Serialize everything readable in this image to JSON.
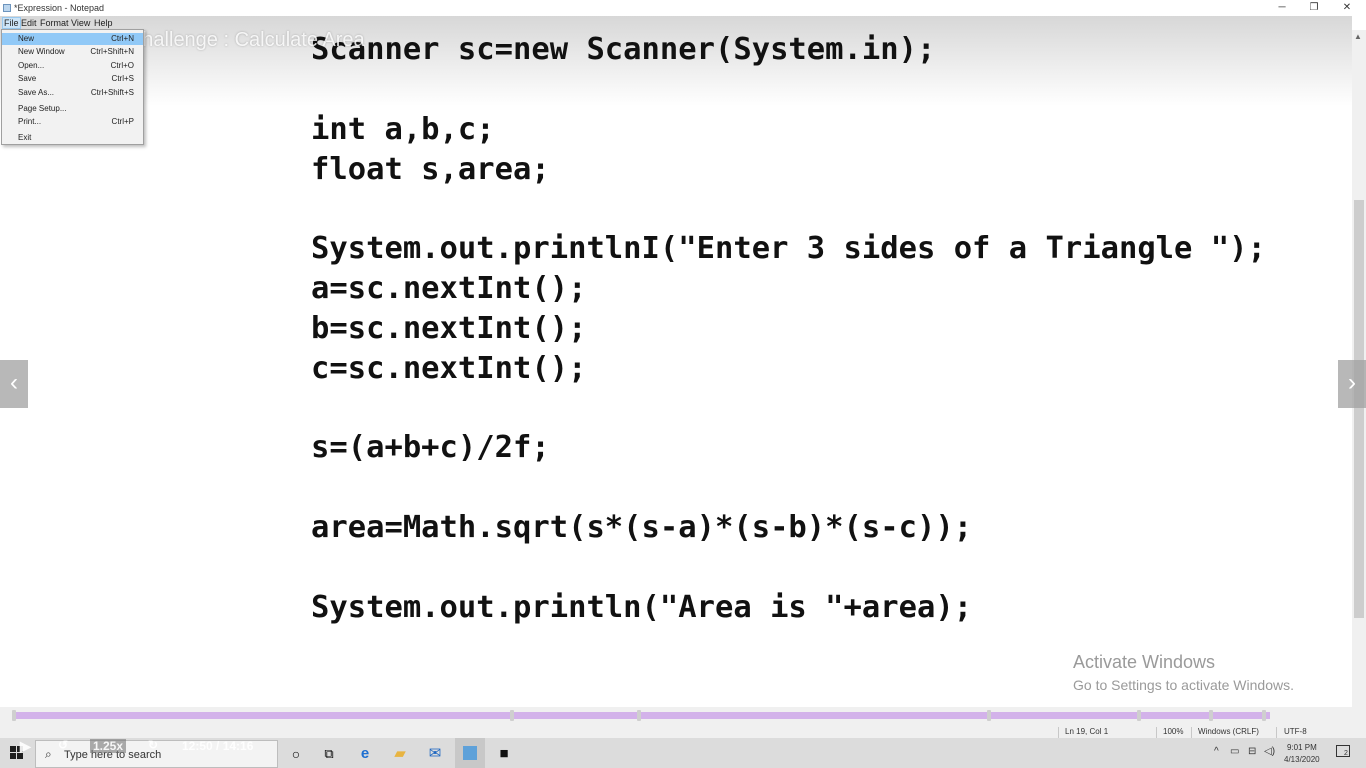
{
  "window": {
    "title": "*Expression - Notepad",
    "controls": {
      "minimize": "─",
      "maximize": "❐",
      "close": "✕"
    }
  },
  "menubar": {
    "items": [
      "File",
      "Edit",
      "Format",
      "View",
      "Help"
    ]
  },
  "video": {
    "title": "31. Student Challenge : Calculate Area",
    "speed": "1.25x",
    "time": "12:50 / 14:16",
    "prev_arrow": "‹",
    "next_arrow": "›"
  },
  "file_menu": [
    {
      "label": "New",
      "shortcut": "Ctrl+N"
    },
    {
      "label": "New Window",
      "shortcut": "Ctrl+Shift+N"
    },
    {
      "label": "Open...",
      "shortcut": "Ctrl+O"
    },
    {
      "label": "Save",
      "shortcut": "Ctrl+S"
    },
    {
      "label": "Save As...",
      "shortcut": "Ctrl+Shift+S"
    },
    {
      "label": "Page Setup...",
      "shortcut": ""
    },
    {
      "label": "Print...",
      "shortcut": "Ctrl+P"
    },
    {
      "label": "Exit",
      "shortcut": ""
    }
  ],
  "editor": {
    "lines": [
      "Scanner sc=new Scanner(System.in);",
      "",
      "int a,b,c;",
      "float s,area;",
      "",
      "System.out.printlnI(\"Enter 3 sides of a Triangle \");",
      "a=sc.nextInt();",
      "b=sc.nextInt();",
      "c=sc.nextInt();",
      "",
      "s=(a+b+c)/2f;",
      "",
      "area=Math.sqrt(s*(s-a)*(s-b)*(s-c));",
      "",
      "System.out.println(\"Area is \"+area);"
    ]
  },
  "watermark": {
    "line1": "Activate Windows",
    "line2": "Go to Settings to activate Windows."
  },
  "statusbar": {
    "position": "Ln 19, Col 1",
    "zoom": "100%",
    "line_ending": "Windows (CRLF)",
    "encoding": "UTF-8"
  },
  "taskbar": {
    "search_placeholder": "Type here to search",
    "time": "9:01 PM",
    "date": "4/13/2020",
    "notification_count": "2"
  },
  "colors": {
    "progress": "#d3b2ea",
    "menu_highlight": "#91c9f7",
    "edge_blue": "#1e6fd1"
  }
}
